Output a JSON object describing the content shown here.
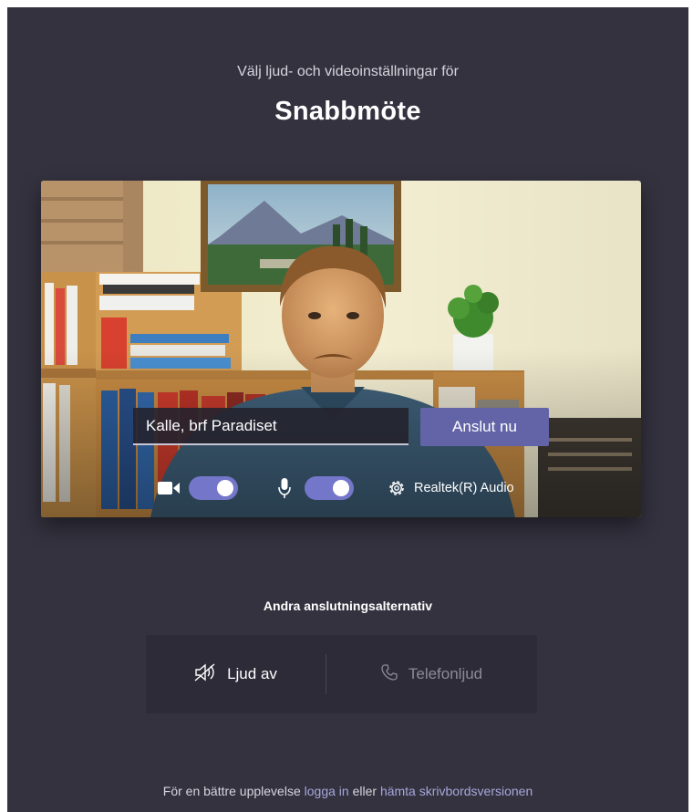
{
  "prejoin": {
    "subtitle": "Välj ljud- och videoinställningar för",
    "meeting_title": "Snabbmöte"
  },
  "preview": {
    "name_value": "Kalle, brf Paradiset",
    "join_label": "Anslut nu",
    "camera_on": true,
    "microphone_on": true,
    "audio_device": "Realtek(R) Audio"
  },
  "alternatives": {
    "heading": "Andra anslutningsalternativ",
    "audio_off_label": "Ljud av",
    "phone_label": "Telefonljud"
  },
  "footer": {
    "prefix": "För en bättre upplevelse",
    "login_link": "logga in",
    "middle": "eller",
    "download_link": "hämta skrivbordsversionen"
  },
  "colors": {
    "background": "#34323f",
    "accent": "#6264a7",
    "toggle_on": "#7376c9",
    "link": "#a6a7dc"
  }
}
